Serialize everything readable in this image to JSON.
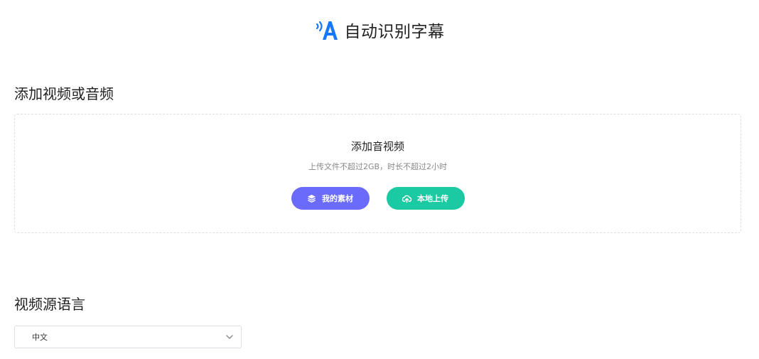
{
  "header": {
    "title": "自动识别字幕",
    "logo_icon": "speech-a-icon",
    "logo_color": "#1677ff"
  },
  "upload_section": {
    "title": "添加视频或音频",
    "heading": "添加音视频",
    "hint": "上传文件不超过2GB，时长不超过2小时",
    "buttons": {
      "material": {
        "label": "我的素材",
        "icon": "layers-icon",
        "color": "#6a6bfa"
      },
      "local": {
        "label": "本地上传",
        "icon": "cloud-upload-icon",
        "color": "#1bc9a2"
      }
    }
  },
  "language_section": {
    "title": "视频源语言",
    "selected": "中文",
    "icon": "chevron-down-icon"
  }
}
